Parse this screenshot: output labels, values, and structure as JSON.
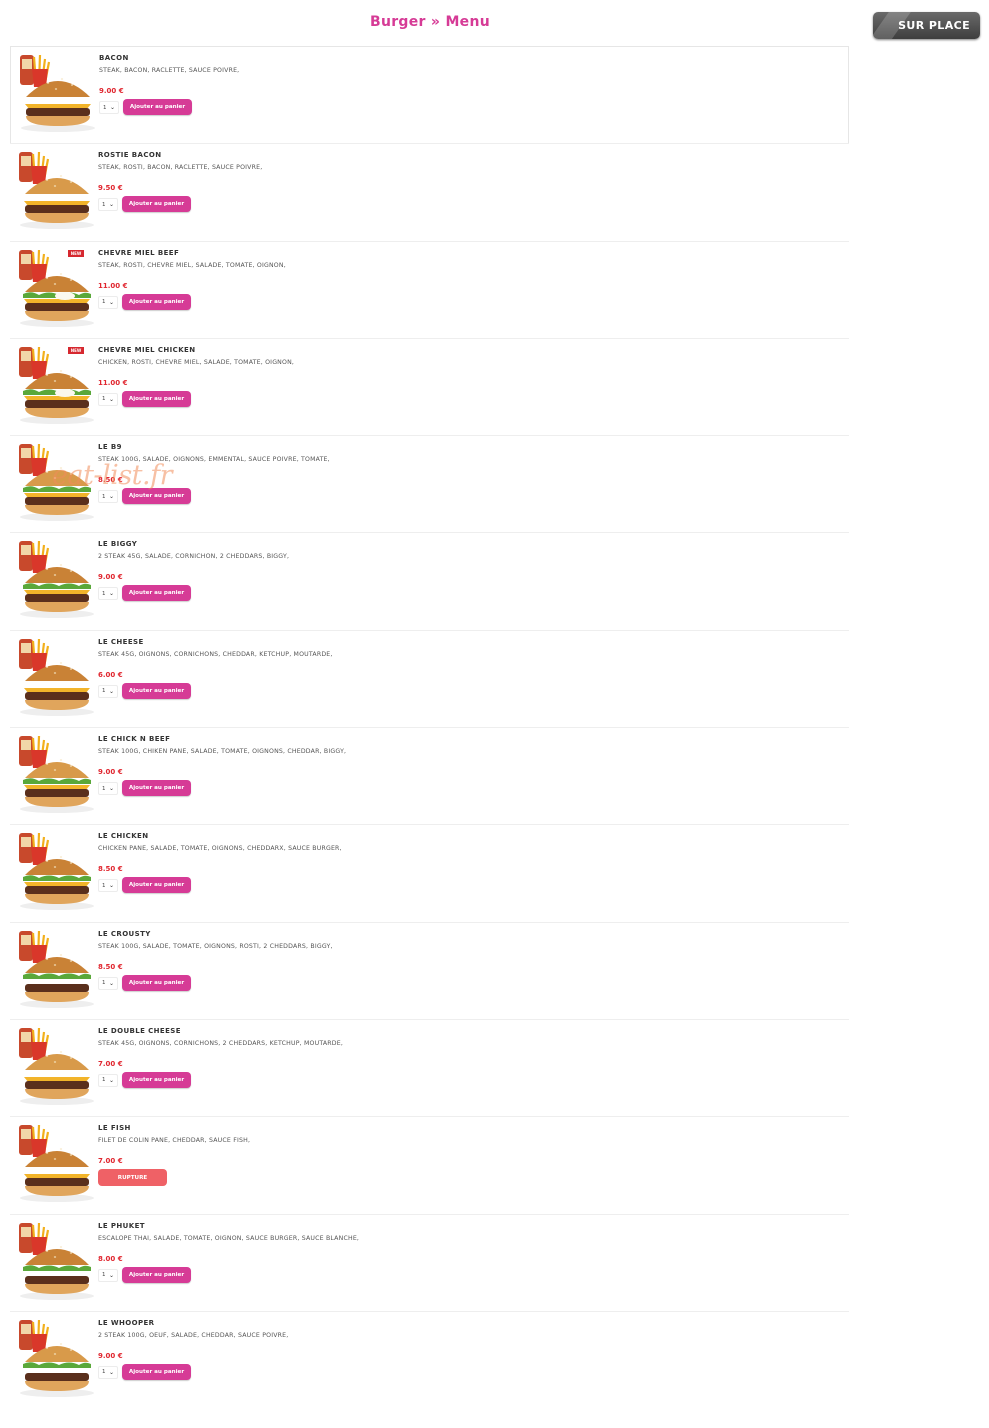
{
  "header": {
    "title": "Burger » Menu",
    "sur_place": "SUR PLACE"
  },
  "watermark": "eat-list.fr",
  "add_label": "Ajouter au panier",
  "qty_default": "1",
  "colors": {
    "accent": "#d63b96",
    "price": "#e0262f",
    "rupture": "#ef6166"
  },
  "items": [
    {
      "name": "BACON",
      "desc": "STEAK, BACON, RACLETTE, SAUCE POIVRE,",
      "price": "9.00 €",
      "status": "available"
    },
    {
      "name": "ROSTIE BACON",
      "desc": "STEAK, ROSTI, BACON, RACLETTE, SAUCE POIVRE,",
      "price": "9.50 €",
      "status": "available"
    },
    {
      "name": "CHEVRE MIEL BEEF",
      "desc": "STEAK, ROSTI, CHEVRE MIEL, SALADE, TOMATE, OIGNON,",
      "price": "11.00 €",
      "status": "available",
      "badge": "NEW"
    },
    {
      "name": "CHEVRE MIEL CHICKEN",
      "desc": "CHICKEN, ROSTI, CHEVRE MIEL, SALADE, TOMATE, OIGNON,",
      "price": "11.00 €",
      "status": "available",
      "badge": "NEW"
    },
    {
      "name": "LE B9",
      "desc": "STEAK 100G, SALADE, OIGNONS, EMMENTAL, SAUCE POIVRE, TOMATE,",
      "price": "8.50 €",
      "status": "available"
    },
    {
      "name": "LE BIGGY",
      "desc": "2 STEAK 45G, SALADE, CORNICHON, 2 CHEDDARS, BIGGY,",
      "price": "9.00 €",
      "status": "available"
    },
    {
      "name": "LE CHEESE",
      "desc": "STEAK 45G, OIGNONS, CORNICHONS, CHEDDAR, KETCHUP, MOUTARDE,",
      "price": "6.00 €",
      "status": "available"
    },
    {
      "name": "LE CHICK N BEEF",
      "desc": "STEAK 100G, CHIKEN PANE, SALADE, TOMATE, OIGNONS, CHEDDAR, BIGGY,",
      "price": "9.00 €",
      "status": "available"
    },
    {
      "name": "LE CHICKEN",
      "desc": "CHICKEN PANE, SALADE, TOMATE, OIGNONS, CHEDDARX, SAUCE BURGER,",
      "price": "8.50 €",
      "status": "available"
    },
    {
      "name": "LE CROUSTY",
      "desc": "STEAK 100G, SALADE, TOMATE, OIGNONS, ROSTI, 2 CHEDDARS, BIGGY,",
      "price": "8.50 €",
      "status": "available"
    },
    {
      "name": "LE DOUBLE CHEESE",
      "desc": "STEAK 45G, OIGNONS, CORNICHONS, 2 CHEDDARS, KETCHUP, MOUTARDE,",
      "price": "7.00 €",
      "status": "available"
    },
    {
      "name": "LE FISH",
      "desc": "FILET DE COLIN PANE, CHEDDAR, SAUCE FISH,",
      "price": "7.00 €",
      "status": "rupture",
      "rupture_label": "RUPTURE"
    },
    {
      "name": "LE PHUKET",
      "desc": "ESCALOPE THAI, SALADE, TOMATE, OIGNON, SAUCE BURGER, SAUCE BLANCHE,",
      "price": "8.00 €",
      "status": "available"
    },
    {
      "name": "LE WHOOPER",
      "desc": "2 STEAK 100G, OEUF, SALADE, CHEDDAR, SAUCE POIVRE,",
      "price": "9.00 €",
      "status": "available"
    }
  ]
}
